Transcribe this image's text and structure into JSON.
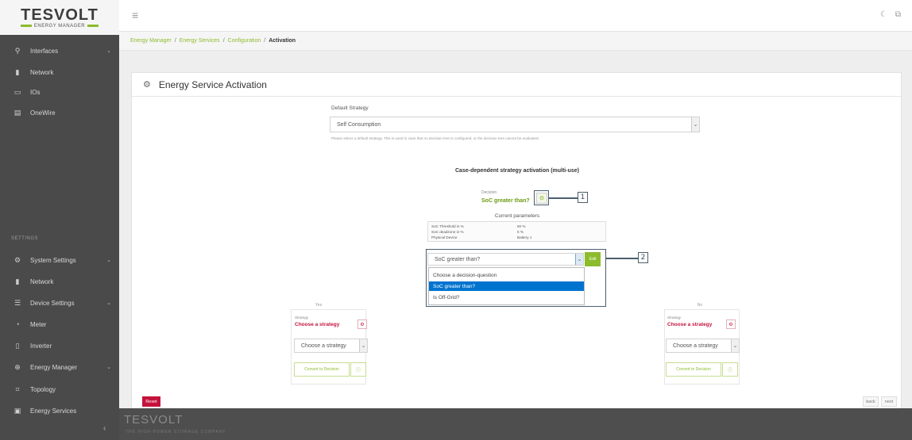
{
  "brand": {
    "logo_text": "TESVOLT",
    "logo_sub": "ENERGY MANAGER"
  },
  "sidebar": {
    "items": [
      {
        "label": "Interfaces",
        "icon": "plug-icon",
        "glyph": "⚲",
        "has_children": true
      },
      {
        "label": "Network",
        "icon": "network-icon",
        "glyph": "▮",
        "has_children": false
      },
      {
        "label": "IOs",
        "icon": "io-icon",
        "glyph": "▭",
        "has_children": false
      },
      {
        "label": "OneWire",
        "icon": "onewire-icon",
        "glyph": "▤",
        "has_children": false
      }
    ],
    "settings_label": "SETTINGS",
    "settings_items": [
      {
        "label": "System Settings",
        "icon": "gear-icon",
        "glyph": "⚙",
        "has_children": true
      },
      {
        "label": "Network",
        "icon": "network-icon",
        "glyph": "▮",
        "has_children": false
      },
      {
        "label": "Device Settings",
        "icon": "sliders-icon",
        "glyph": "☰",
        "has_children": true
      },
      {
        "label": "Meter",
        "icon": "meter-icon",
        "glyph": "◔",
        "has_children": false
      },
      {
        "label": "Inverter",
        "icon": "inverter-icon",
        "glyph": "▯",
        "has_children": false
      },
      {
        "label": "Energy Manager",
        "icon": "energy-manager-icon",
        "glyph": "⊕",
        "has_children": true
      },
      {
        "label": "Topology",
        "icon": "topology-icon",
        "glyph": "⌗",
        "has_children": false
      },
      {
        "label": "Energy Services",
        "icon": "energy-services-icon",
        "glyph": "▣",
        "has_children": false
      }
    ],
    "collapse_glyph": "‹"
  },
  "topbar": {
    "menu_glyph": "≡",
    "theme_glyph": "☾",
    "lang_glyph": "⧉"
  },
  "breadcrumb": [
    "Energy Manager",
    "Energy Services",
    "Configuration",
    "Activation"
  ],
  "breadcrumb_sep": "/",
  "card": {
    "title": "Energy Service Activation",
    "header_glyph": "⚙",
    "default_strategy_label": "Default Strategy",
    "default_strategy_value": "Self Consumption",
    "default_strategy_hint": "Please select a default strategy. This is used in case that no decision tree is configured, or the decision tree cannot be evaluated.",
    "section_title": "Case-dependent strategy activation (multi-use)",
    "decision_caption": "Decision",
    "decision_value": "SoC greater than?",
    "params_title": "Current parameters",
    "params": [
      {
        "key": "SoC Threshold in %",
        "value": "50 %"
      },
      {
        "key": "SoC deadzone in %",
        "value": "5 %"
      },
      {
        "key": "Physical Device",
        "value": "Battery 1"
      }
    ],
    "decision_select_value": "SoC greater than?",
    "edit_button_label": "Edit",
    "dropdown_options": [
      {
        "label": "Choose a decision-question",
        "selected": false
      },
      {
        "label": "SoC greater than?",
        "selected": true
      },
      {
        "label": "Is Off-Grid?",
        "selected": false
      }
    ],
    "branches": [
      {
        "label": "Yes",
        "strategy_caption": "Strategy",
        "strategy_value": "Choose a strategy",
        "select_value": "Choose a strategy",
        "convert_label": "Convert to Decision"
      },
      {
        "label": "No",
        "strategy_caption": "Strategy",
        "strategy_value": "Choose a strategy",
        "select_value": "Choose a strategy",
        "convert_label": "Convert to Decision"
      }
    ],
    "reset_label": "Reset",
    "back_label": "back",
    "next_label": "next"
  },
  "callouts": [
    "1",
    "2"
  ],
  "footer": {
    "logo_text": "TESVOLT",
    "sub_text": "THE HIGH-POWER STORAGE COMPANY"
  },
  "colors": {
    "accent_green": "#8cbc2c",
    "danger_red": "#c4123c",
    "sidebar_bg": "#4a4a4a",
    "selection_blue": "#0073cf"
  }
}
